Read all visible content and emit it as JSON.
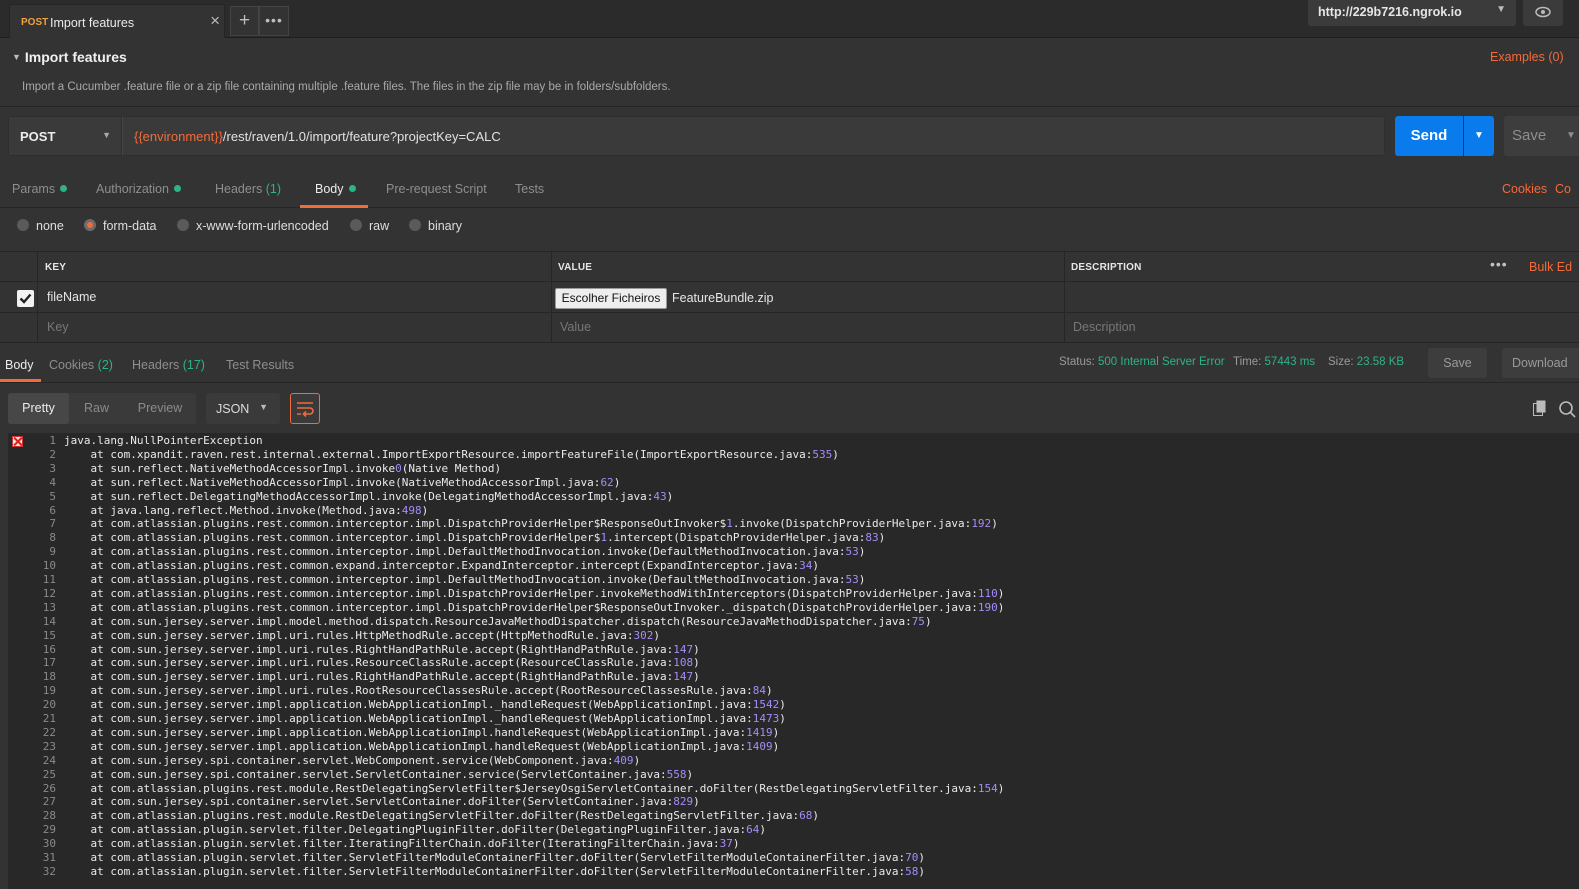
{
  "tab": {
    "method": "POST",
    "title": "Import features",
    "close": "×"
  },
  "tabbar": {
    "add": "+",
    "more": "•••"
  },
  "environment": {
    "value": "http://229b7216.ngrok.io"
  },
  "request": {
    "name": "Import features",
    "examples": "Examples (0)",
    "description": "Import a Cucumber .feature file or a zip file containing multiple .feature files. The files in the zip file may be in folders/subfolders.",
    "method": "POST",
    "url_variable": "{{environment}}",
    "url_path": "/rest/raven/1.0/import/feature?projectKey=CALC",
    "send": "Send",
    "save": "Save"
  },
  "request_tabs": [
    {
      "label": "Params",
      "count": "",
      "dot": true
    },
    {
      "label": "Authorization",
      "count": "",
      "dot": true
    },
    {
      "label": "Headers",
      "count": "(1)",
      "dot": false
    },
    {
      "label": "Body",
      "count": "",
      "dot": true,
      "active": true
    },
    {
      "label": "Pre-request Script",
      "count": "",
      "dot": false
    },
    {
      "label": "Tests",
      "count": "",
      "dot": false
    }
  ],
  "request_links": {
    "cookies": "Cookies",
    "code": "Co"
  },
  "body_types": [
    "none",
    "form-data",
    "x-www-form-urlencoded",
    "raw",
    "binary"
  ],
  "body_type_selected": "form-data",
  "form_table": {
    "headers": {
      "key": "KEY",
      "value": "VALUE",
      "description": "DESCRIPTION"
    },
    "bulk_edit": "Bulk Ed",
    "more": "•••",
    "rows": [
      {
        "checked": true,
        "key": "fileName",
        "file_button": "Escolher Ficheiros",
        "value": "FeatureBundle.zip",
        "description": ""
      }
    ],
    "placeholders": {
      "key": "Key",
      "value": "Value",
      "description": "Description"
    }
  },
  "response": {
    "tabs": [
      {
        "label": "Body",
        "count": "",
        "active": true
      },
      {
        "label": "Cookies",
        "count": "(2)"
      },
      {
        "label": "Headers",
        "count": "(17)"
      },
      {
        "label": "Test Results",
        "count": ""
      }
    ],
    "status_label": "Status:",
    "status": "500 Internal Server Error",
    "time_label": "Time:",
    "time": "57443 ms",
    "size_label": "Size:",
    "size": "23.58 KB",
    "save": "Save",
    "download": "Download",
    "views": [
      "Pretty",
      "Raw",
      "Preview"
    ],
    "view_selected": "Pretty",
    "format": "JSON",
    "lines": [
      "java.lang.NullPointerException",
      "    at com.xpandit.raven.rest.internal.external.ImportExportResource.importFeatureFile(ImportExportResource.java:535)",
      "    at sun.reflect.NativeMethodAccessorImpl.invoke0(Native Method)",
      "    at sun.reflect.NativeMethodAccessorImpl.invoke(NativeMethodAccessorImpl.java:62)",
      "    at sun.reflect.DelegatingMethodAccessorImpl.invoke(DelegatingMethodAccessorImpl.java:43)",
      "    at java.lang.reflect.Method.invoke(Method.java:498)",
      "    at com.atlassian.plugins.rest.common.interceptor.impl.DispatchProviderHelper$ResponseOutInvoker$1.invoke(DispatchProviderHelper.java:192)",
      "    at com.atlassian.plugins.rest.common.interceptor.impl.DispatchProviderHelper$1.intercept(DispatchProviderHelper.java:83)",
      "    at com.atlassian.plugins.rest.common.interceptor.impl.DefaultMethodInvocation.invoke(DefaultMethodInvocation.java:53)",
      "    at com.atlassian.plugins.rest.common.expand.interceptor.ExpandInterceptor.intercept(ExpandInterceptor.java:34)",
      "    at com.atlassian.plugins.rest.common.interceptor.impl.DefaultMethodInvocation.invoke(DefaultMethodInvocation.java:53)",
      "    at com.atlassian.plugins.rest.common.interceptor.impl.DispatchProviderHelper.invokeMethodWithInterceptors(DispatchProviderHelper.java:110)",
      "    at com.atlassian.plugins.rest.common.interceptor.impl.DispatchProviderHelper$ResponseOutInvoker._dispatch(DispatchProviderHelper.java:190)",
      "    at com.sun.jersey.server.impl.model.method.dispatch.ResourceJavaMethodDispatcher.dispatch(ResourceJavaMethodDispatcher.java:75)",
      "    at com.sun.jersey.server.impl.uri.rules.HttpMethodRule.accept(HttpMethodRule.java:302)",
      "    at com.sun.jersey.server.impl.uri.rules.RightHandPathRule.accept(RightHandPathRule.java:147)",
      "    at com.sun.jersey.server.impl.uri.rules.ResourceClassRule.accept(ResourceClassRule.java:108)",
      "    at com.sun.jersey.server.impl.uri.rules.RightHandPathRule.accept(RightHandPathRule.java:147)",
      "    at com.sun.jersey.server.impl.uri.rules.RootResourceClassesRule.accept(RootResourceClassesRule.java:84)",
      "    at com.sun.jersey.server.impl.application.WebApplicationImpl._handleRequest(WebApplicationImpl.java:1542)",
      "    at com.sun.jersey.server.impl.application.WebApplicationImpl._handleRequest(WebApplicationImpl.java:1473)",
      "    at com.sun.jersey.server.impl.application.WebApplicationImpl.handleRequest(WebApplicationImpl.java:1419)",
      "    at com.sun.jersey.server.impl.application.WebApplicationImpl.handleRequest(WebApplicationImpl.java:1409)",
      "    at com.sun.jersey.spi.container.servlet.WebComponent.service(WebComponent.java:409)",
      "    at com.sun.jersey.spi.container.servlet.ServletContainer.service(ServletContainer.java:558)",
      "    at com.atlassian.plugins.rest.module.RestDelegatingServletFilter$JerseyOsgiServletContainer.doFilter(RestDelegatingServletFilter.java:154)",
      "    at com.sun.jersey.spi.container.servlet.ServletContainer.doFilter(ServletContainer.java:829)",
      "    at com.atlassian.plugins.rest.module.RestDelegatingServletFilter.doFilter(RestDelegatingServletFilter.java:68)",
      "    at com.atlassian.plugin.servlet.filter.DelegatingPluginFilter.doFilter(DelegatingPluginFilter.java:64)",
      "    at com.atlassian.plugin.servlet.filter.IteratingFilterChain.doFilter(IteratingFilterChain.java:37)",
      "    at com.atlassian.plugin.servlet.filter.ServletFilterModuleContainerFilter.doFilter(ServletFilterModuleContainerFilter.java:70)",
      "    at com.atlassian.plugin.servlet.filter.ServletFilterModuleContainerFilter.doFilter(ServletFilterModuleContainerFilter.java:58)"
    ]
  },
  "colors": {
    "accent": "#f26b3a",
    "send": "#097bed",
    "success_green": "#2db38a",
    "number_purple": "#a78bfa"
  },
  "icons": [
    "close-icon",
    "plus-icon",
    "more-icon",
    "eye-icon",
    "caret-down-icon",
    "checkbox-icon",
    "wrap-lines-icon",
    "copy-icon",
    "search-icon",
    "error-icon"
  ]
}
